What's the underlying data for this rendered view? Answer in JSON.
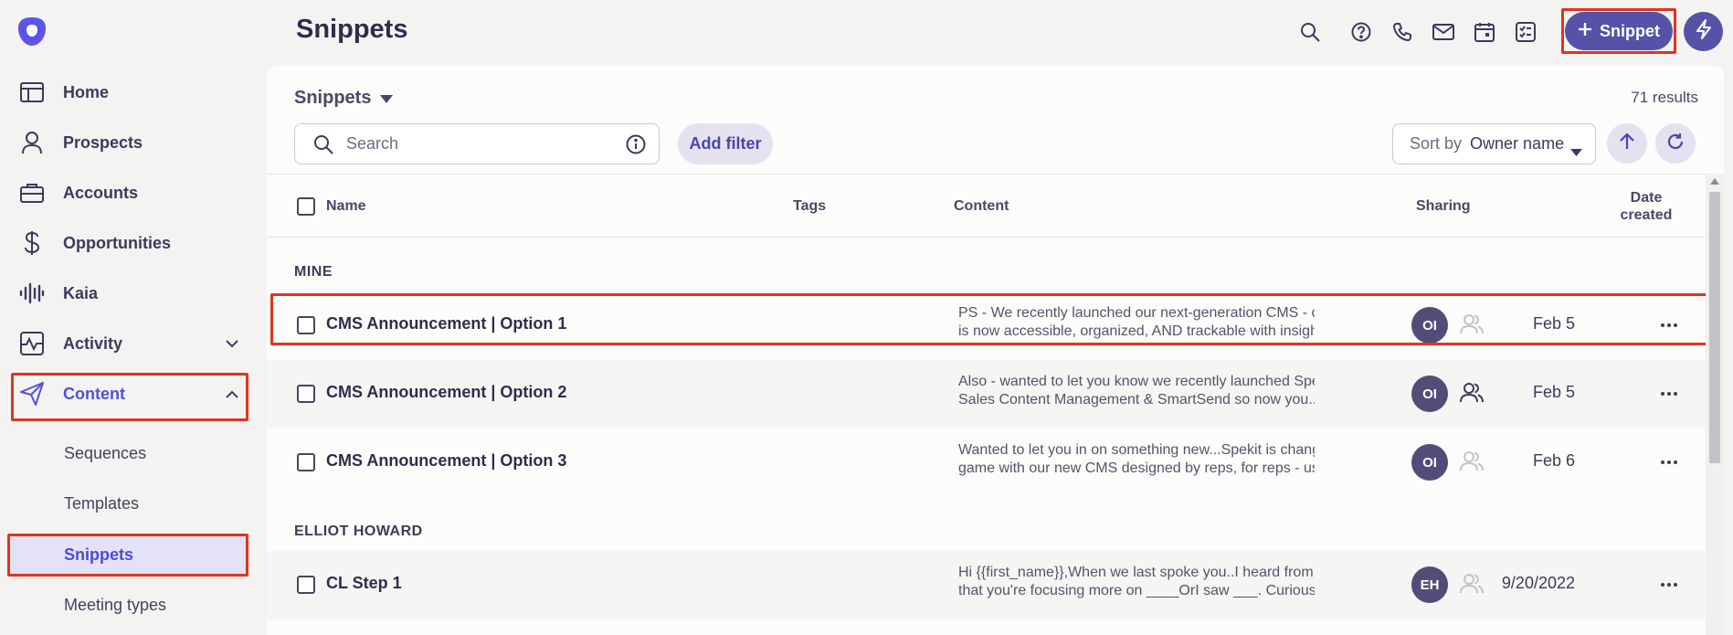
{
  "sidebar": {
    "items": [
      {
        "label": "Home",
        "icon": "home-icon"
      },
      {
        "label": "Prospects",
        "icon": "person-icon"
      },
      {
        "label": "Accounts",
        "icon": "briefcase-icon"
      },
      {
        "label": "Opportunities",
        "icon": "dollar-icon"
      },
      {
        "label": "Kaia",
        "icon": "waveform-icon"
      },
      {
        "label": "Activity",
        "icon": "activity-icon"
      },
      {
        "label": "Content",
        "icon": "send-icon"
      }
    ],
    "content_subitems": [
      "Sequences",
      "Templates",
      "Snippets",
      "Meeting types"
    ]
  },
  "header": {
    "title": "Snippets",
    "new_button_label": "Snippet",
    "icons": [
      "search-icon",
      "help-icon",
      "phone-icon",
      "mail-icon",
      "calendar-icon",
      "tasks-icon",
      "bolt-icon"
    ]
  },
  "panel": {
    "title": "Snippets",
    "results": "71 results",
    "search_placeholder": "Search",
    "add_filter": "Add filter",
    "sort_label": "Sort by",
    "sort_value": "Owner name"
  },
  "table": {
    "columns": {
      "name": "Name",
      "tags": "Tags",
      "content": "Content",
      "sharing": "Sharing",
      "date_line1": "Date",
      "date_line2": "created"
    },
    "groups": [
      {
        "label": "MINE",
        "rows": [
          {
            "name": "CMS Announcement | Option 1",
            "content_1": "PS - We recently launched our next-generation CMS - content",
            "content_2": "is now accessible, organized, AND trackable with insights int...",
            "avatar": "OI",
            "shared": false,
            "date": "Feb 5"
          },
          {
            "name": "CMS Announcement | Option 2",
            "content_1": "Also - wanted to let you know we recently launched Spekit's",
            "content_2": "Sales Content Management & SmartSend so now you...",
            "avatar": "OI",
            "shared": true,
            "date": "Feb 5"
          },
          {
            "name": "CMS Announcement | Option 3",
            "content_1": "Wanted to let you in on something new...Spekit is changing the",
            "content_2": "game with our new CMS designed by reps, for reps - users...",
            "avatar": "OI",
            "shared": false,
            "date": "Feb 6"
          }
        ]
      },
      {
        "label": "ELLIOT HOWARD",
        "rows": [
          {
            "name": "CL Step 1",
            "content_1": "Hi {{first_name}},When we last spoke you..I heard from ____",
            "content_2": "that you're focusing more on ____OrI saw ___. Curious if that...",
            "avatar": "EH",
            "shared": false,
            "date": "9/20/2022"
          }
        ]
      }
    ]
  },
  "colors": {
    "accent": "#5652a8",
    "highlight": "#e0341f",
    "active_text": "#5451d6"
  }
}
